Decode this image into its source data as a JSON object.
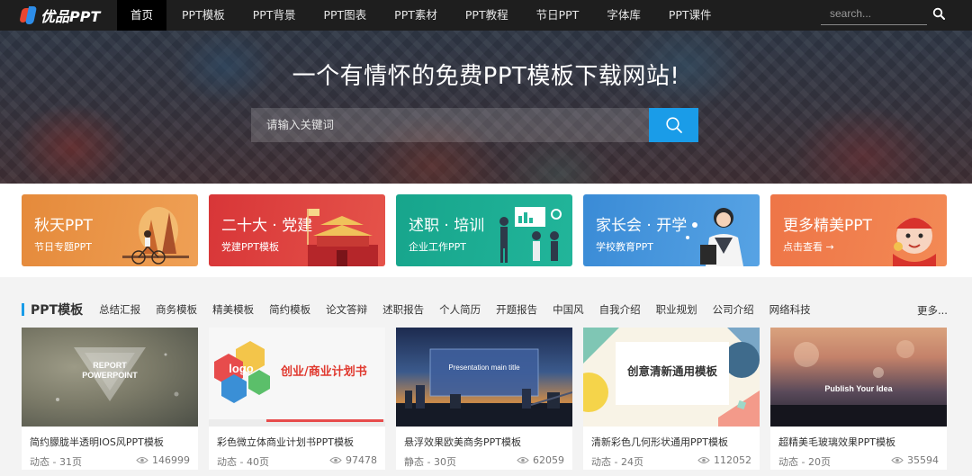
{
  "nav": {
    "logo_text": "优品PPT",
    "items": [
      {
        "label": "首页"
      },
      {
        "label": "PPT模板"
      },
      {
        "label": "PPT背景"
      },
      {
        "label": "PPT图表"
      },
      {
        "label": "PPT素材"
      },
      {
        "label": "PPT教程"
      },
      {
        "label": "节日PPT"
      },
      {
        "label": "字体库"
      },
      {
        "label": "PPT课件"
      }
    ],
    "active_index": 0,
    "search_placeholder": "search..."
  },
  "hero": {
    "title": "一个有情怀的免费PPT模板下载网站!",
    "search_placeholder": "请输入关键词"
  },
  "banners": [
    {
      "title": "秋天PPT",
      "subtitle": "节日专题PPT",
      "color": "#e7913f"
    },
    {
      "title": "二十大 · 党建",
      "subtitle": "党建PPT模板",
      "color": "#d93a3a"
    },
    {
      "title": "述职 · 培训",
      "subtitle": "企业工作PPT",
      "color": "#1aa58f"
    },
    {
      "title": "家长会 · 开学",
      "subtitle": "学校教育PPT",
      "color": "#3d8fd8"
    },
    {
      "title": "更多精美PPT",
      "subtitle": "点击查看 →",
      "color": "#ef7a4a"
    }
  ],
  "section": {
    "title": "PPT模板",
    "categories": [
      "总结汇报",
      "商务模板",
      "精美模板",
      "简约模板",
      "论文答辩",
      "述职报告",
      "个人简历",
      "开题报告",
      "中国风",
      "自我介绍",
      "职业规划",
      "公司介绍",
      "网络科技"
    ],
    "more": "更多..."
  },
  "cards": [
    {
      "title": "简约朦胧半透明IOS风PPT模板",
      "meta": "动态 - 31页",
      "views": "146999",
      "thumb_text": "REPORT POWERPOINT"
    },
    {
      "title": "彩色微立体商业计划书PPT模板",
      "meta": "动态 - 40页",
      "views": "97478",
      "thumb_text": "创业/商业计划书",
      "thumb_logo": "logo"
    },
    {
      "title": "悬浮效果欧美商务PPT模板",
      "meta": "静态 - 30页",
      "views": "62059",
      "thumb_text": "Presentation main title"
    },
    {
      "title": "清新彩色几何形状通用PPT模板",
      "meta": "动态 - 24页",
      "views": "112052",
      "thumb_text": "创意清新通用模板"
    },
    {
      "title": "超精美毛玻璃效果PPT模板",
      "meta": "动态 - 20页",
      "views": "35594",
      "thumb_text": "Publish Your Idea"
    }
  ],
  "colors": {
    "accent": "#1a9ce8",
    "nav_bg": "#1e1e1e"
  }
}
